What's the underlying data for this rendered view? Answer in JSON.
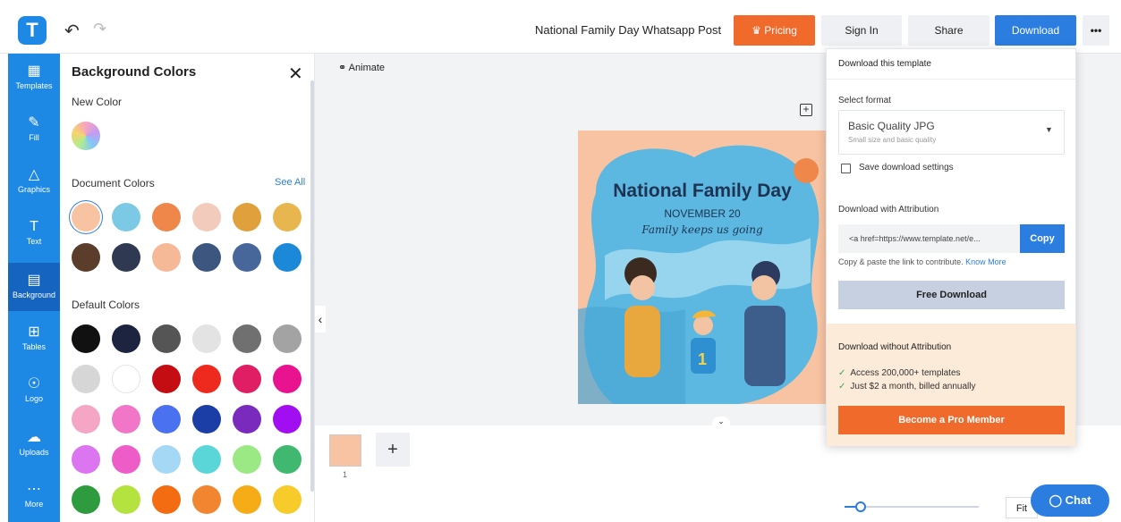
{
  "app": {
    "logo_letter": "T",
    "doc_title": "National Family Day Whatsapp Post",
    "undo_icon": "undo-icon",
    "redo_icon": "redo-icon"
  },
  "toolbar": {
    "pricing": "Pricing",
    "sign_in": "Sign In",
    "share": "Share",
    "download": "Download",
    "more": "•••"
  },
  "rail": {
    "items": [
      {
        "label": "Templates",
        "icon": "templates-icon"
      },
      {
        "label": "Fill",
        "icon": "fill-icon"
      },
      {
        "label": "Graphics",
        "icon": "graphics-icon"
      },
      {
        "label": "Text",
        "icon": "text-icon"
      },
      {
        "label": "Background",
        "icon": "background-icon"
      },
      {
        "label": "Tables",
        "icon": "tables-icon"
      },
      {
        "label": "Logo",
        "icon": "logo-icon"
      },
      {
        "label": "Uploads",
        "icon": "uploads-icon"
      },
      {
        "label": "More",
        "icon": "more-icon"
      }
    ],
    "active": "Background"
  },
  "panel": {
    "title": "Background Colors",
    "new_color_label": "New Color",
    "document_colors_label": "Document Colors",
    "see_all": "See All",
    "default_colors_label": "Default Colors",
    "document_colors": [
      "#f7c3a2",
      "#7cc9e6",
      "#f0874a",
      "#f2cbbd",
      "#e0a13d",
      "#e8b64e",
      "#5a3e2b",
      "#2f3a52",
      "#f5b998",
      "#3d5680",
      "#47679b",
      "#1c88d8"
    ],
    "default_colors": [
      "#111111",
      "#1c2440",
      "#555555",
      "#e3e3e3",
      "#707070",
      "#a3a3a3",
      "#d6d6d6",
      "#ffffff",
      "#c40d12",
      "#ee2a1e",
      "#e01e63",
      "#ea138f",
      "#f4a6c4",
      "#f276c8",
      "#4a72f0",
      "#1a3ea6",
      "#7a2bbe",
      "#a10ef2",
      "#dc75f0",
      "#ee5dc7",
      "#a5d8f5",
      "#5ad6d9",
      "#9ae985",
      "#40b870",
      "#2e9c3e",
      "#b4e23e",
      "#f36c12",
      "#f28530",
      "#f6ac17",
      "#f6cb2a"
    ],
    "selected_document_color": "#f7c3a2"
  },
  "canvas": {
    "animate": "Animate",
    "design": {
      "title": "National Family Day",
      "date": "NOVEMBER 20",
      "tagline": "Family keeps us going"
    },
    "page_number": "1",
    "zoom_fit": "Fit",
    "zoom_level_fraction": 0.12
  },
  "download_menu": {
    "header": "Download this template",
    "select_format_label": "Select format",
    "format_name": "Basic Quality JPG",
    "format_desc": "Small size and basic quality",
    "save_settings_label": "Save download settings",
    "save_settings_checked": false,
    "attribution_label": "Download with Attribution",
    "attribution_value": "<a href=https://www.template.net/e...",
    "copy_label": "Copy",
    "hint_text": "Copy & paste the link to contribute.",
    "hint_link": "Know More",
    "free_download": "Free Download",
    "pro_title": "Download without Attribution",
    "benefits": [
      "Access 200,000+ templates",
      "Just $2 a month, billed annually"
    ],
    "pro_button": "Become a Pro Member"
  },
  "chat": {
    "label": "Chat"
  },
  "colors": {
    "brand_blue": "#2b7de0",
    "rail_blue": "#1e88e5",
    "accent_orange": "#f06a2b",
    "canvas_bg": "#f7c3a2"
  }
}
